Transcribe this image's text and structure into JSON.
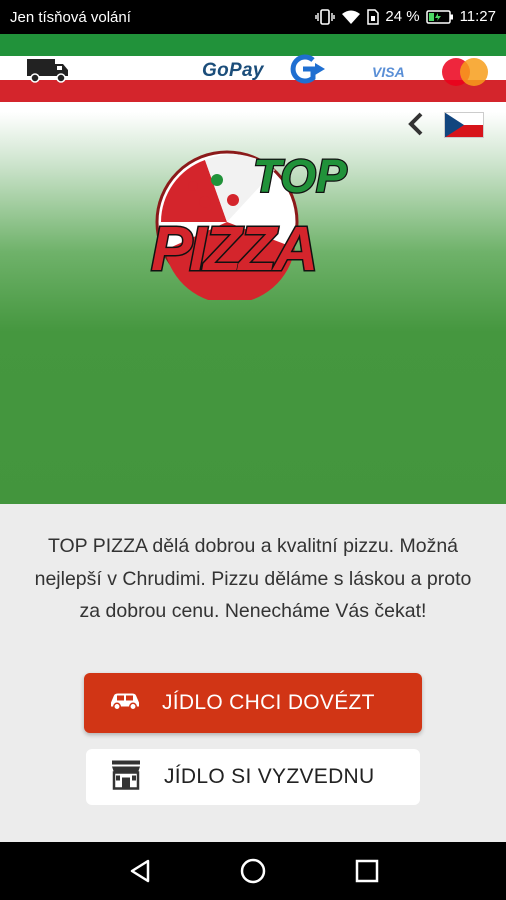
{
  "status_bar": {
    "carrier": "Jen tísňová volání",
    "battery": "24 %",
    "time": "11:27",
    "icons": [
      "vibrate-icon",
      "wifi-icon",
      "sim-icon",
      "battery-icon"
    ]
  },
  "banner": {
    "gopay_label": "GoPay",
    "visa_label": "VISA",
    "icons": [
      "delivery-van-icon",
      "gopay-g-icon",
      "mastercard-icon"
    ],
    "colors": {
      "green": "#21923a",
      "white": "#ffffff",
      "red": "#d4252c"
    }
  },
  "header": {
    "back_icon": "chevron-left-icon",
    "language_flag": "czech-flag-icon"
  },
  "logo": {
    "top_text": "TOP",
    "pizza_text": "PIZZA"
  },
  "description": "TOP PIZZA dělá dobrou a kvalitní pizzu. Možná nejlepší v Chrudimi. Pizzu děláme s láskou a proto za dobrou cenu. Nenecháme Vás čekat!",
  "buttons": {
    "deliver_label": "JÍDLO CHCI DOVÉZT",
    "deliver_icon": "car-icon",
    "pickup_label": "JÍDLO SI VYZVEDNU",
    "pickup_icon": "shop-icon",
    "colors": {
      "deliver_bg": "#d13515",
      "pickup_bg": "#ffffff"
    }
  },
  "nav": {
    "icons": [
      "back-triangle-icon",
      "home-circle-icon",
      "recents-square-icon"
    ]
  }
}
